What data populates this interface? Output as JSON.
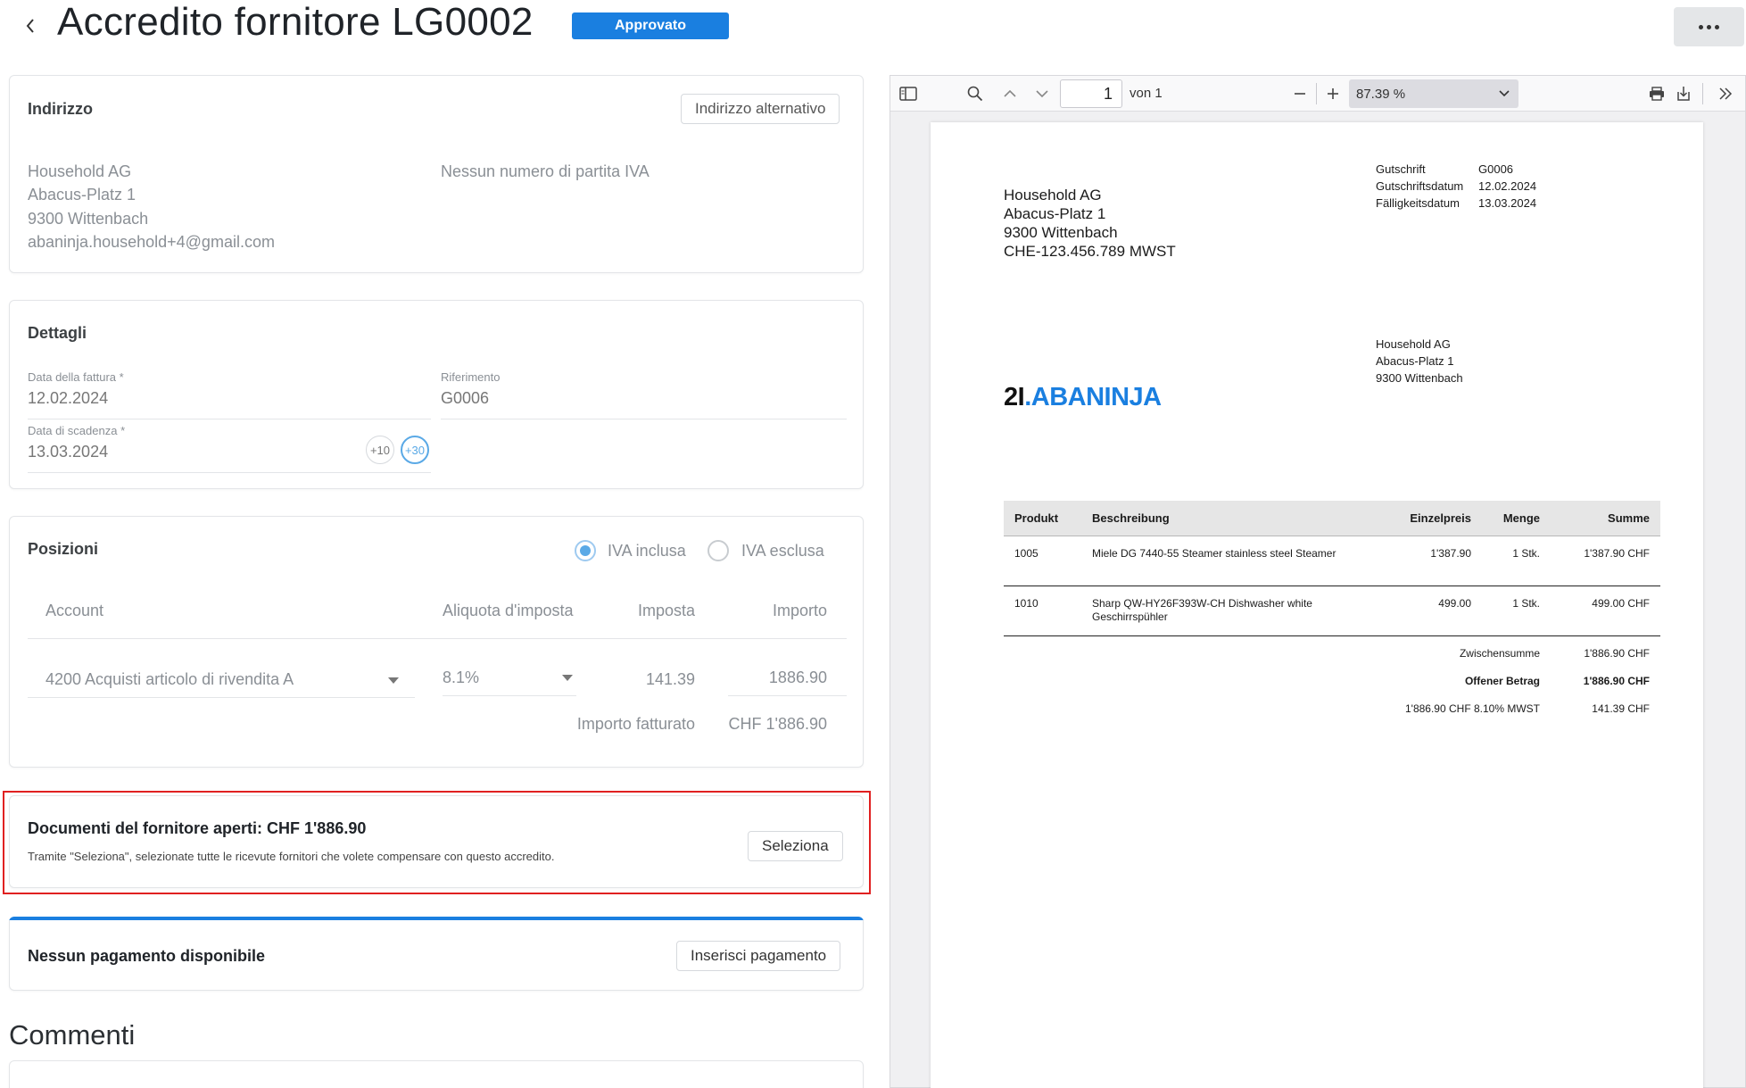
{
  "header": {
    "title": "Accredito fornitore LG0002",
    "status": "Approvato"
  },
  "address": {
    "title": "Indirizzo",
    "alt_button": "Indirizzo alternativo",
    "lines": [
      "Household AG",
      "Abacus-Platz 1",
      "9300 Wittenbach",
      "abaninja.household+4@gmail.com"
    ],
    "vat_note": "Nessun numero di partita IVA"
  },
  "details": {
    "title": "Dettagli",
    "invoice_date_label": "Data della fattura *",
    "invoice_date": "12.02.2024",
    "reference_label": "Riferimento",
    "reference": "G0006",
    "due_date_label": "Data di scadenza *",
    "due_date": "13.03.2024",
    "quick_10": "+10",
    "quick_30": "+30"
  },
  "positions": {
    "title": "Posizioni",
    "vat_included": "IVA inclusa",
    "vat_excluded": "IVA esclusa",
    "vat_included_selected": true,
    "columns": [
      "Account",
      "Aliquota d'imposta",
      "Imposta",
      "Importo"
    ],
    "row": {
      "account": "4200 Acquisti articolo di rivendita A",
      "rate": "8.1%",
      "tax": "141.39",
      "amount": "1886.90"
    },
    "billed_label": "Importo fatturato",
    "billed_value": "CHF 1'886.90"
  },
  "open_docs": {
    "title": "Documenti del fornitore aperti: CHF 1'886.90",
    "description": "Tramite \"Seleziona\", selezionate tutte le ricevute fornitori che volete compensare con questo accredito.",
    "select_button": "Seleziona"
  },
  "payments": {
    "title": "Nessun pagamento disponibile",
    "insert_button": "Inserisci pagamento"
  },
  "comments": {
    "title": "Commenti"
  },
  "pdf_viewer": {
    "page": "1",
    "of_label": "von 1",
    "zoom": "87.39 %",
    "doc": {
      "sender_lines": [
        "Household AG",
        "Abacus-Platz 1",
        "9300 Wittenbach",
        "CHE-123.456.789 MWST"
      ],
      "meta": [
        {
          "label": "Gutschrift",
          "value": "G0006"
        },
        {
          "label": "Gutschriftsdatum",
          "value": "12.02.2024"
        },
        {
          "label": "Fälligkeitsdatum",
          "value": "13.03.2024"
        }
      ],
      "recipient_lines": [
        "Household AG",
        "Abacus-Platz 1",
        "9300 Wittenbach"
      ],
      "logo_number": "2I",
      "logo_word": "ABANINJA",
      "table_headers": [
        "Produkt",
        "Beschreibung",
        "Einzelpreis",
        "Menge",
        "Summe"
      ],
      "items": [
        {
          "product": "1005",
          "description": "Miele DG 7440-55 Steamer stainless steel Steamer",
          "unit_price": "1'387.90",
          "qty": "1 Stk.",
          "total": "1'387.90 CHF"
        },
        {
          "product": "1010",
          "description": "Sharp QW-HY26F393W-CH Dishwasher white Geschirrspühler",
          "unit_price": "499.00",
          "qty": "1 Stk.",
          "total": "499.00 CHF"
        }
      ],
      "subtotal_label": "Zwischensumme",
      "subtotal": "1'886.90 CHF",
      "open_label": "Offener Betrag",
      "open_amount": "1'886.90 CHF",
      "vat_label": "1'886.90 CHF 8.10% MWST",
      "vat_amount": "141.39 CHF"
    }
  }
}
